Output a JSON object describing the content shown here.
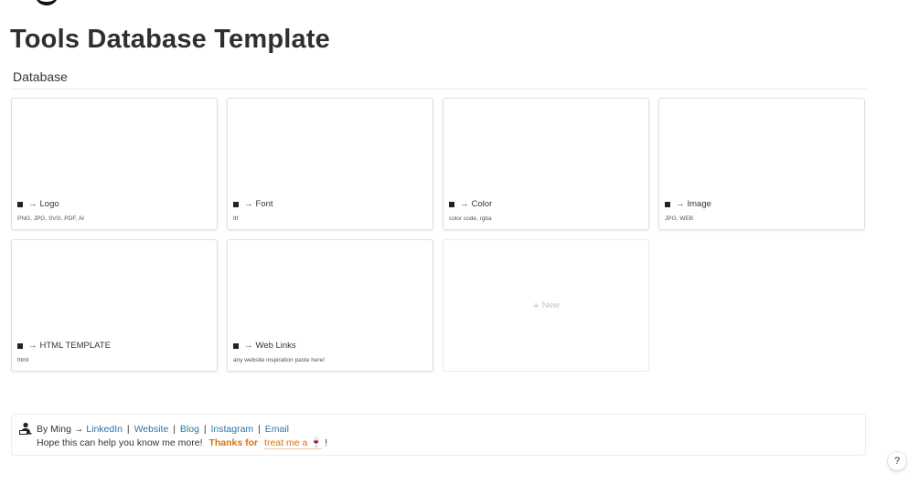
{
  "page": {
    "title": "Tools Database Template"
  },
  "database": {
    "title": "Database",
    "cards": [
      {
        "arrow": "→",
        "name": "Logo",
        "subtitle": "PNG, JPG, SVG, PDF, AI"
      },
      {
        "arrow": "→",
        "name": "Font",
        "subtitle": "ttf"
      },
      {
        "arrow": "→",
        "name": "Color",
        "subtitle": "color code, rgba"
      },
      {
        "arrow": "→",
        "name": "Image",
        "subtitle": "JPG, WEB"
      },
      {
        "arrow": "→",
        "name": "HTML TEMPLATE",
        "subtitle": "html"
      },
      {
        "arrow": "→",
        "name": "Web Links",
        "subtitle": "any website inspiration paste here!"
      }
    ],
    "new_label": "New"
  },
  "callout": {
    "by_text": "By Ming →",
    "links": [
      "LinkedIn",
      "Website",
      "Blog",
      "Instagram",
      "Email"
    ],
    "separator": "|",
    "line2_text": "Hope this can help you know me more!",
    "thanks_text": "Thanks for",
    "treat_text": "treat me a",
    "treat_emoji": "🍷",
    "end_text": "!"
  },
  "help": {
    "label": "?"
  }
}
